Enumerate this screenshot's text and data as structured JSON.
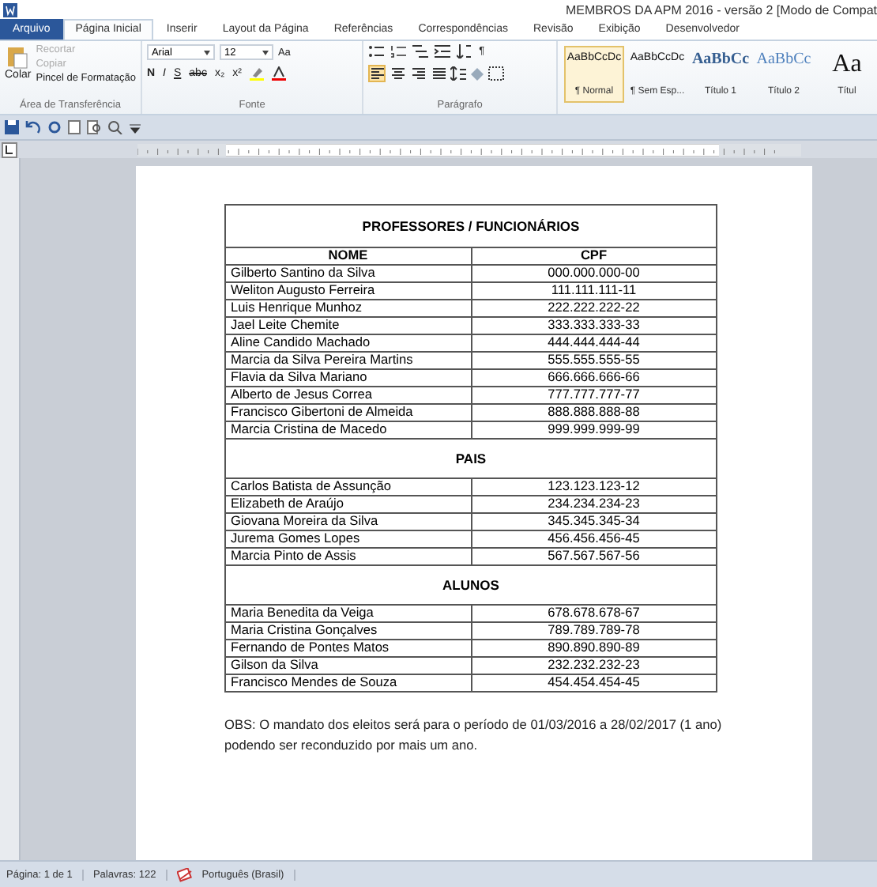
{
  "window": {
    "title": "MEMBROS DA APM 2016 - versão 2 [Modo de Compat"
  },
  "tabs": [
    {
      "label": "Arquivo",
      "kind": "file",
      "selected": false
    },
    {
      "label": "Página Inicial",
      "kind": "tab",
      "selected": true
    },
    {
      "label": "Inserir",
      "kind": "tab",
      "selected": false
    },
    {
      "label": "Layout da Página",
      "kind": "tab",
      "selected": false
    },
    {
      "label": "Referências",
      "kind": "tab",
      "selected": false
    },
    {
      "label": "Correspondências",
      "kind": "tab",
      "selected": false
    },
    {
      "label": "Revisão",
      "kind": "tab",
      "selected": false
    },
    {
      "label": "Exibição",
      "kind": "tab",
      "selected": false
    },
    {
      "label": "Desenvolvedor",
      "kind": "tab",
      "selected": false
    }
  ],
  "ribbon": {
    "clipboard": {
      "paste": "Colar",
      "cut": {
        "label": "Recortar",
        "disabled": true
      },
      "copy": {
        "label": "Copiar",
        "disabled": true
      },
      "format_painter": {
        "label": "Pincel de Formatação",
        "disabled": false
      },
      "group_label": "Área de Transferência"
    },
    "font": {
      "font_name": "Arial",
      "font_size": "12",
      "case_button": "Aa",
      "format_buttons": [
        "N",
        "I",
        "S",
        "abc",
        "x₂",
        "x²"
      ],
      "group_label": "Fonte"
    },
    "paragraph": {
      "group_label": "Parágrafo",
      "pilcrow": "¶",
      "alignments": [
        {
          "selected": true
        },
        {
          "selected": false
        },
        {
          "selected": false
        },
        {
          "selected": false
        }
      ]
    },
    "styles": [
      {
        "preview": "AaBbCcDc",
        "name": "¶ Normal",
        "kind": "body",
        "selected": true
      },
      {
        "preview": "AaBbCcDc",
        "name": "¶ Sem Esp...",
        "kind": "body",
        "selected": false
      },
      {
        "preview": "AaBbCc",
        "name": "Título 1",
        "kind": "heading1",
        "selected": false
      },
      {
        "preview": "AaBbCc",
        "name": "Título 2",
        "kind": "heading2",
        "selected": false
      },
      {
        "preview": "Aa",
        "name": "Títul",
        "kind": "title",
        "selected": false
      }
    ]
  },
  "document": {
    "sections": [
      {
        "title": "PROFESSORES / FUNCIONÁRIOS",
        "header": {
          "name": "NOME",
          "cpf": "CPF"
        },
        "rows": [
          {
            "name": "Gilberto Santino da Silva",
            "cpf": "000.000.000-00"
          },
          {
            "name": "Weliton Augusto Ferreira",
            "cpf": "111.111.111-11"
          },
          {
            "name": "Luis Henrique Munhoz",
            "cpf": "222.222.222-22"
          },
          {
            "name": "Jael Leite Chemite",
            "cpf": "333.333.333-33"
          },
          {
            "name": "Aline Candido Machado",
            "cpf": "444.444.444-44"
          },
          {
            "name": "Marcia da Silva Pereira Martins",
            "cpf": "555.555.555-55"
          },
          {
            "name": "Flavia da Silva Mariano",
            "cpf": "666.666.666-66"
          },
          {
            "name": "Alberto de Jesus Correa",
            "cpf": "777.777.777-77"
          },
          {
            "name": "Francisco Gibertoni de Almeida",
            "cpf": "888.888.888-88"
          },
          {
            "name": "Marcia Cristina de Macedo",
            "cpf": "999.999.999-99"
          }
        ]
      },
      {
        "title": "PAIS",
        "rows": [
          {
            "name": "Carlos Batista de Assunção",
            "cpf": "123.123.123-12"
          },
          {
            "name": "Elizabeth de Araújo",
            "cpf": "234.234.234-23"
          },
          {
            "name": "Giovana Moreira da Silva",
            "cpf": "345.345.345-34"
          },
          {
            "name": "Jurema Gomes Lopes",
            "cpf": "456.456.456-45"
          },
          {
            "name": "Marcia Pinto de Assis",
            "cpf": "567.567.567-56"
          }
        ]
      },
      {
        "title": "ALUNOS",
        "rows": [
          {
            "name": "Maria Benedita da Veiga",
            "cpf": "678.678.678-67"
          },
          {
            "name": "Maria Cristina Gonçalves",
            "cpf": "789.789.789-78"
          },
          {
            "name": "Fernando de Pontes Matos",
            "cpf": "890.890.890-89"
          },
          {
            "name": "Gilson da Silva",
            "cpf": "232.232.232-23"
          },
          {
            "name": "Francisco Mendes de Souza",
            "cpf": "454.454.454-45"
          }
        ]
      }
    ],
    "note": "OBS: O mandato dos eleitos será para o período de 01/03/2016 a 28/02/2017 (1 ano) podendo ser reconduzido por mais um ano."
  },
  "status_bar": {
    "page": "Página: 1 de 1",
    "words": "Palavras: 122",
    "language": "Português (Brasil)"
  }
}
